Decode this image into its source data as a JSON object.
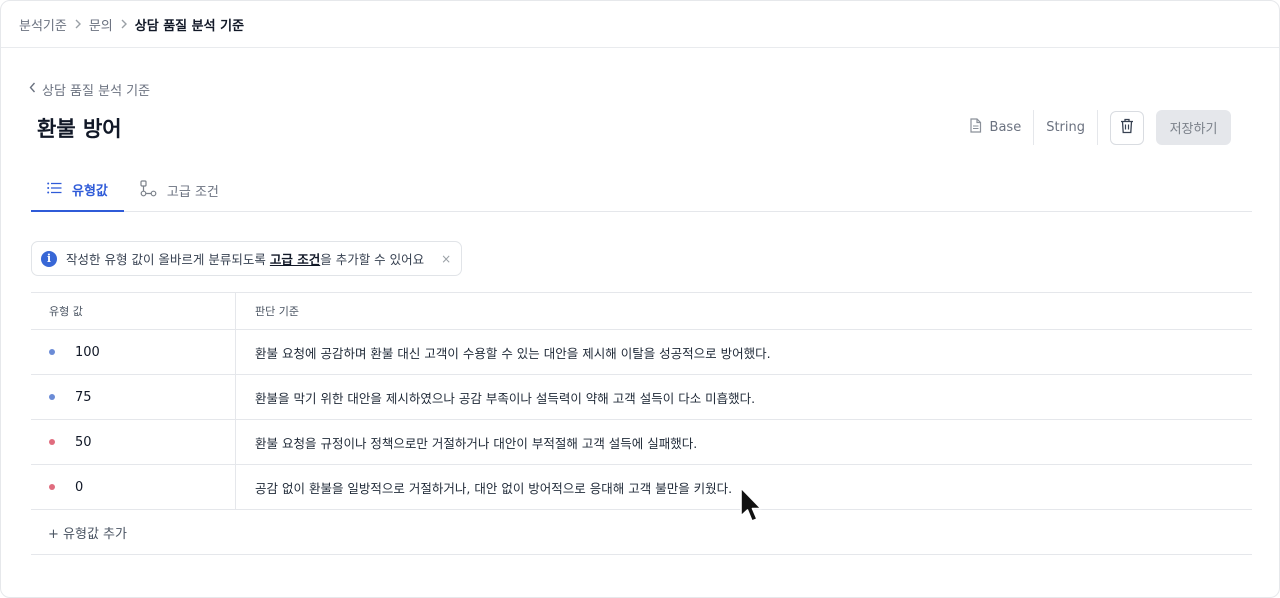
{
  "breadcrumb": {
    "items": [
      "분석기준",
      "문의"
    ],
    "current": "상담 품질 분석 기준"
  },
  "header": {
    "back_label": "상담 품질 분석 기준",
    "title": "환불 방어",
    "base_label": "Base",
    "type_label": "String",
    "save_label": "저장하기"
  },
  "tabs": [
    {
      "label": "유형값",
      "active": true
    },
    {
      "label": "고급 조건",
      "active": false
    }
  ],
  "notice": {
    "text_before": "작성한 유형 값이 올바르게 분류되도록 ",
    "link": "고급 조건",
    "text_after": "을 추가할 수 있어요",
    "close": "×"
  },
  "table": {
    "headers": [
      "유형 값",
      "판단 기준"
    ],
    "rows": [
      {
        "value": "100",
        "color": "#6b8bd6",
        "criteria": "환불 요청에 공감하며 환불 대신 고객이 수용할 수 있는 대안을 제시해 이탈을 성공적으로 방어했다."
      },
      {
        "value": "75",
        "color": "#6b8bd6",
        "criteria": "환불을 막기 위한 대안을 제시하였으나 공감 부족이나 설득력이 약해 고객 설득이 다소 미흡했다."
      },
      {
        "value": "50",
        "color": "#e06c7e",
        "criteria": "환불 요청을 규정이나 정책으로만 거절하거나 대안이 부적절해 고객 설득에 실패했다."
      },
      {
        "value": "0",
        "color": "#e06c7e",
        "criteria": "공감 없이 환불을 일방적으로 거절하거나, 대안 없이 방어적으로 응대해 고객 불만을 키웠다."
      }
    ],
    "add_label": "+ 유형값 추가"
  }
}
